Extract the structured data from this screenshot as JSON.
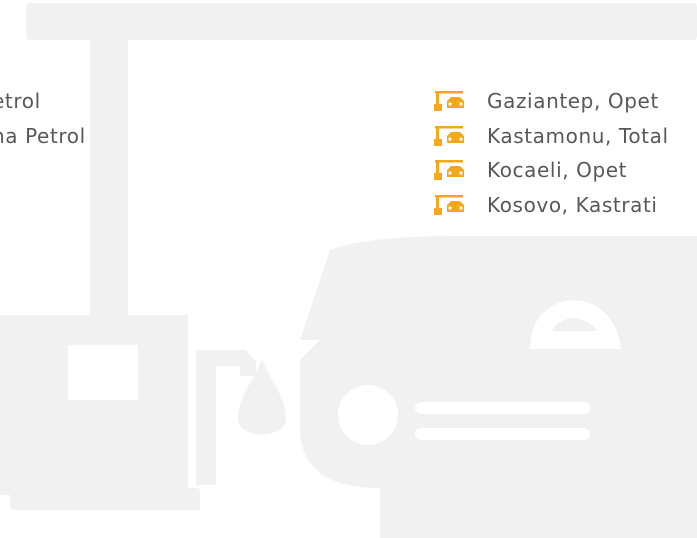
{
  "colors": {
    "background": "#ffffff",
    "illustration": "#f1f1f1",
    "text": "#585858",
    "icon_accent": "#f6a81c"
  },
  "left_list": {
    "items": [
      {
        "label": "etrol"
      },
      {
        "label": "na Petrol"
      }
    ]
  },
  "right_list": {
    "icon": "fuel-station-car-icon",
    "items": [
      {
        "label": "Gaziantep, Opet"
      },
      {
        "label": "Kastamonu, Total"
      },
      {
        "label": "Kocaeli, Opet"
      },
      {
        "label": "Kosovo, Kastrati"
      }
    ]
  }
}
